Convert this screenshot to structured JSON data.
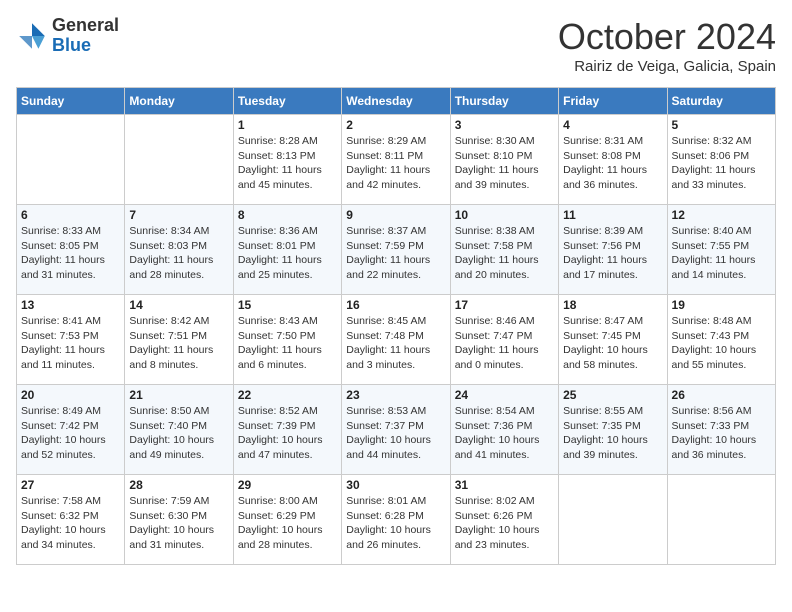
{
  "header": {
    "logo": {
      "general": "General",
      "blue": "Blue"
    },
    "title": "October 2024",
    "subtitle": "Rairiz de Veiga, Galicia, Spain"
  },
  "weekdays": [
    "Sunday",
    "Monday",
    "Tuesday",
    "Wednesday",
    "Thursday",
    "Friday",
    "Saturday"
  ],
  "weeks": [
    [
      {
        "day": "",
        "info": ""
      },
      {
        "day": "",
        "info": ""
      },
      {
        "day": "1",
        "info": "Sunrise: 8:28 AM\nSunset: 8:13 PM\nDaylight: 11 hours and 45 minutes."
      },
      {
        "day": "2",
        "info": "Sunrise: 8:29 AM\nSunset: 8:11 PM\nDaylight: 11 hours and 42 minutes."
      },
      {
        "day": "3",
        "info": "Sunrise: 8:30 AM\nSunset: 8:10 PM\nDaylight: 11 hours and 39 minutes."
      },
      {
        "day": "4",
        "info": "Sunrise: 8:31 AM\nSunset: 8:08 PM\nDaylight: 11 hours and 36 minutes."
      },
      {
        "day": "5",
        "info": "Sunrise: 8:32 AM\nSunset: 8:06 PM\nDaylight: 11 hours and 33 minutes."
      }
    ],
    [
      {
        "day": "6",
        "info": "Sunrise: 8:33 AM\nSunset: 8:05 PM\nDaylight: 11 hours and 31 minutes."
      },
      {
        "day": "7",
        "info": "Sunrise: 8:34 AM\nSunset: 8:03 PM\nDaylight: 11 hours and 28 minutes."
      },
      {
        "day": "8",
        "info": "Sunrise: 8:36 AM\nSunset: 8:01 PM\nDaylight: 11 hours and 25 minutes."
      },
      {
        "day": "9",
        "info": "Sunrise: 8:37 AM\nSunset: 7:59 PM\nDaylight: 11 hours and 22 minutes."
      },
      {
        "day": "10",
        "info": "Sunrise: 8:38 AM\nSunset: 7:58 PM\nDaylight: 11 hours and 20 minutes."
      },
      {
        "day": "11",
        "info": "Sunrise: 8:39 AM\nSunset: 7:56 PM\nDaylight: 11 hours and 17 minutes."
      },
      {
        "day": "12",
        "info": "Sunrise: 8:40 AM\nSunset: 7:55 PM\nDaylight: 11 hours and 14 minutes."
      }
    ],
    [
      {
        "day": "13",
        "info": "Sunrise: 8:41 AM\nSunset: 7:53 PM\nDaylight: 11 hours and 11 minutes."
      },
      {
        "day": "14",
        "info": "Sunrise: 8:42 AM\nSunset: 7:51 PM\nDaylight: 11 hours and 8 minutes."
      },
      {
        "day": "15",
        "info": "Sunrise: 8:43 AM\nSunset: 7:50 PM\nDaylight: 11 hours and 6 minutes."
      },
      {
        "day": "16",
        "info": "Sunrise: 8:45 AM\nSunset: 7:48 PM\nDaylight: 11 hours and 3 minutes."
      },
      {
        "day": "17",
        "info": "Sunrise: 8:46 AM\nSunset: 7:47 PM\nDaylight: 11 hours and 0 minutes."
      },
      {
        "day": "18",
        "info": "Sunrise: 8:47 AM\nSunset: 7:45 PM\nDaylight: 10 hours and 58 minutes."
      },
      {
        "day": "19",
        "info": "Sunrise: 8:48 AM\nSunset: 7:43 PM\nDaylight: 10 hours and 55 minutes."
      }
    ],
    [
      {
        "day": "20",
        "info": "Sunrise: 8:49 AM\nSunset: 7:42 PM\nDaylight: 10 hours and 52 minutes."
      },
      {
        "day": "21",
        "info": "Sunrise: 8:50 AM\nSunset: 7:40 PM\nDaylight: 10 hours and 49 minutes."
      },
      {
        "day": "22",
        "info": "Sunrise: 8:52 AM\nSunset: 7:39 PM\nDaylight: 10 hours and 47 minutes."
      },
      {
        "day": "23",
        "info": "Sunrise: 8:53 AM\nSunset: 7:37 PM\nDaylight: 10 hours and 44 minutes."
      },
      {
        "day": "24",
        "info": "Sunrise: 8:54 AM\nSunset: 7:36 PM\nDaylight: 10 hours and 41 minutes."
      },
      {
        "day": "25",
        "info": "Sunrise: 8:55 AM\nSunset: 7:35 PM\nDaylight: 10 hours and 39 minutes."
      },
      {
        "day": "26",
        "info": "Sunrise: 8:56 AM\nSunset: 7:33 PM\nDaylight: 10 hours and 36 minutes."
      }
    ],
    [
      {
        "day": "27",
        "info": "Sunrise: 7:58 AM\nSunset: 6:32 PM\nDaylight: 10 hours and 34 minutes."
      },
      {
        "day": "28",
        "info": "Sunrise: 7:59 AM\nSunset: 6:30 PM\nDaylight: 10 hours and 31 minutes."
      },
      {
        "day": "29",
        "info": "Sunrise: 8:00 AM\nSunset: 6:29 PM\nDaylight: 10 hours and 28 minutes."
      },
      {
        "day": "30",
        "info": "Sunrise: 8:01 AM\nSunset: 6:28 PM\nDaylight: 10 hours and 26 minutes."
      },
      {
        "day": "31",
        "info": "Sunrise: 8:02 AM\nSunset: 6:26 PM\nDaylight: 10 hours and 23 minutes."
      },
      {
        "day": "",
        "info": ""
      },
      {
        "day": "",
        "info": ""
      }
    ]
  ]
}
